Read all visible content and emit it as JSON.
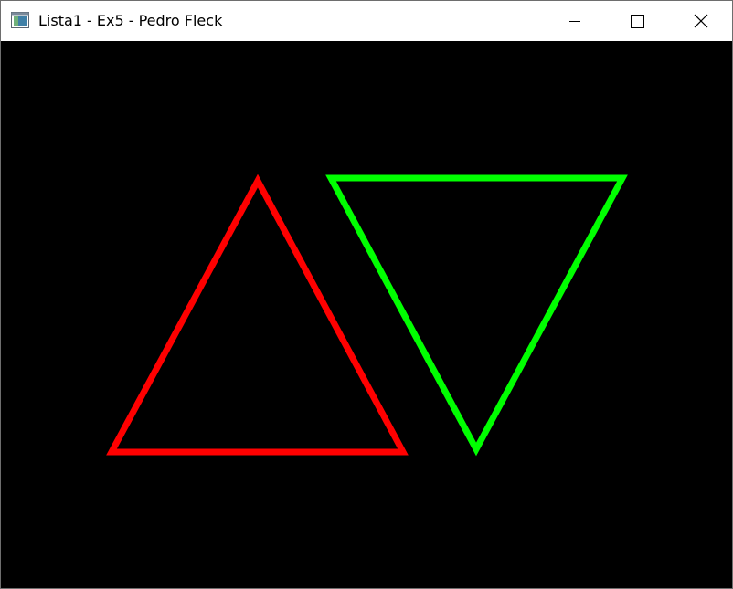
{
  "window": {
    "title": "Lista1 - Ex5 - Pedro Fleck",
    "icon": "app-window-icon",
    "controls": [
      "minimize-icon",
      "maximize-icon",
      "close-icon"
    ]
  },
  "canvas": {
    "background": "#000000",
    "shapes": [
      {
        "name": "red-triangle",
        "kind": "triangle-up",
        "color": "#ff0000"
      },
      {
        "name": "green-triangle",
        "kind": "triangle-down",
        "color": "#00ff00"
      }
    ]
  }
}
